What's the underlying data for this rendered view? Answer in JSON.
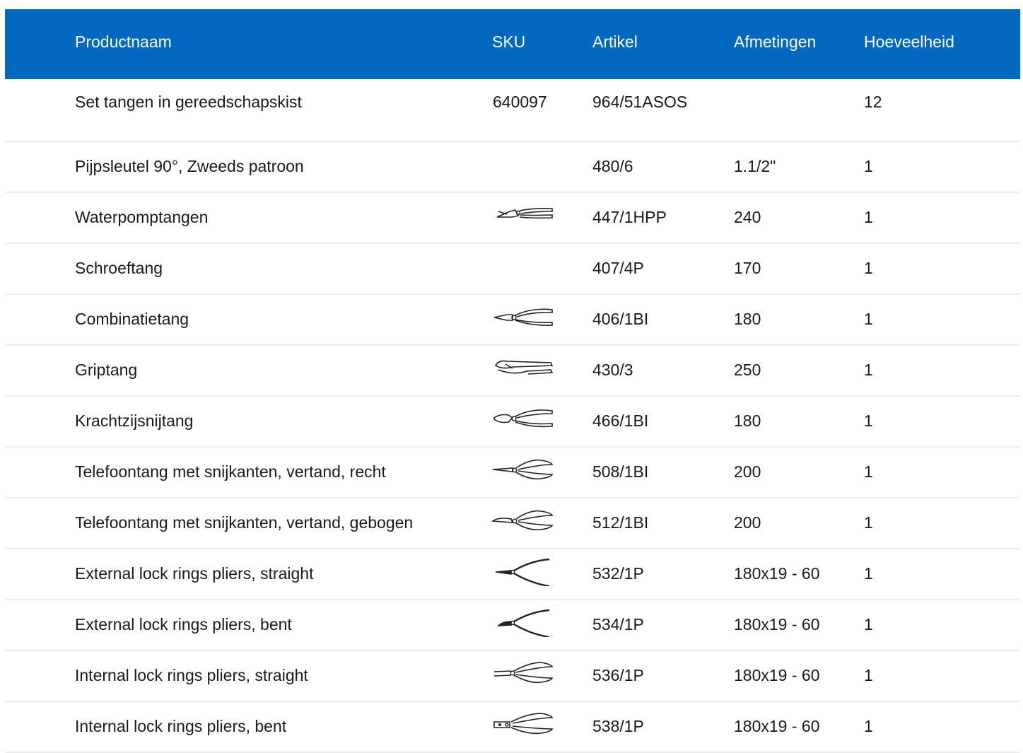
{
  "columns": {
    "name": "Productnaam",
    "sku": "SKU",
    "article": "Artikel",
    "dimensions": "Afmetingen",
    "quantity": "Hoeveelheid"
  },
  "rows": [
    {
      "name": "Set tangen in gereedschapskist",
      "sku": "640097",
      "article": "964/51ASOS",
      "dimensions": "",
      "quantity": "12",
      "icon": ""
    },
    {
      "name": "Pijpsleutel 90°, Zweeds patroon",
      "sku": "",
      "article": "480/6",
      "dimensions": "1.1/2\"",
      "quantity": "1",
      "icon": ""
    },
    {
      "name": "Waterpomptangen",
      "sku": "",
      "article": "447/1HPP",
      "dimensions": "240",
      "quantity": "1",
      "icon": "water-pump-pliers-icon"
    },
    {
      "name": "Schroeftang",
      "sku": "",
      "article": "407/4P",
      "dimensions": "170",
      "quantity": "1",
      "icon": ""
    },
    {
      "name": "Combinatietang",
      "sku": "",
      "article": "406/1BI",
      "dimensions": "180",
      "quantity": "1",
      "icon": "combination-pliers-icon"
    },
    {
      "name": "Griptang",
      "sku": "",
      "article": "430/3",
      "dimensions": "250",
      "quantity": "1",
      "icon": "locking-pliers-icon"
    },
    {
      "name": "Krachtzijsnijtang",
      "sku": "",
      "article": "466/1BI",
      "dimensions": "180",
      "quantity": "1",
      "icon": "side-cutter-icon"
    },
    {
      "name": "Telefoontang met snijkanten, vertand, recht",
      "sku": "",
      "article": "508/1BI",
      "dimensions": "200",
      "quantity": "1",
      "icon": "long-nose-pliers-icon"
    },
    {
      "name": "Telefoontang met snijkanten, vertand, gebogen",
      "sku": "",
      "article": "512/1BI",
      "dimensions": "200",
      "quantity": "1",
      "icon": "bent-nose-pliers-icon"
    },
    {
      "name": "External lock rings pliers, straight",
      "sku": "",
      "article": "532/1P",
      "dimensions": "180x19 - 60",
      "quantity": "1",
      "icon": "external-circlip-pliers-icon"
    },
    {
      "name": "External lock rings pliers, bent",
      "sku": "",
      "article": "534/1P",
      "dimensions": "180x19 - 60",
      "quantity": "1",
      "icon": "external-circlip-bent-pliers-icon"
    },
    {
      "name": "Internal lock rings pliers, straight",
      "sku": "",
      "article": "536/1P",
      "dimensions": "180x19 - 60",
      "quantity": "1",
      "icon": "internal-circlip-pliers-icon"
    },
    {
      "name": "Internal lock rings pliers, bent",
      "sku": "",
      "article": "538/1P",
      "dimensions": "180x19 - 60",
      "quantity": "1",
      "icon": "internal-circlip-bent-pliers-icon"
    }
  ],
  "colors": {
    "header_background": "#0068bf",
    "header_text": "#ffffff",
    "row_divider": "#ececec"
  }
}
